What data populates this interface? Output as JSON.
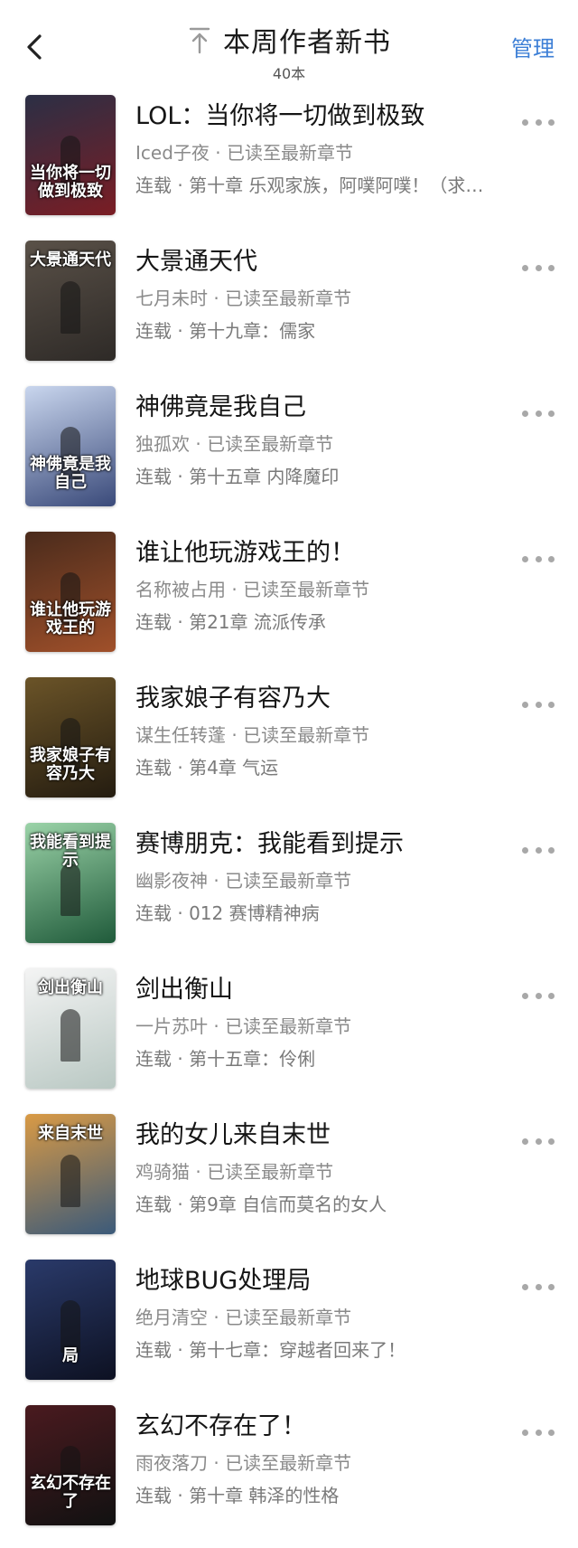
{
  "header": {
    "title": "本周作者新书",
    "count": "40本",
    "manage_label": "管理",
    "icons": {
      "back": "chevron-left-icon",
      "up": "arrow-up-to-top-icon"
    },
    "accent_color": "#3d7fd6"
  },
  "separator": " · ",
  "books": [
    {
      "title": "LOL：当你将一切做到极致",
      "author": "Iced子夜",
      "progress": "已读至最新章节",
      "status": "连载",
      "chapter": "第十章 乐观家族，阿噗阿噗！（求…",
      "cover_text": "当你将一切做到极致",
      "cover_colors": [
        "#2b2f45",
        "#7a1d24"
      ]
    },
    {
      "title": "大景通天代",
      "author": "七月未时",
      "progress": "已读至最新章节",
      "status": "连载",
      "chapter": "第十九章：儒家",
      "cover_text": "大景通天代",
      "cover_colors": [
        "#5a5148",
        "#2e2a27"
      ]
    },
    {
      "title": "神佛竟是我自己",
      "author": "独孤欢",
      "progress": "已读至最新章节",
      "status": "连载",
      "chapter": "第十五章 内降魔印",
      "cover_text": "神佛竟是我自己",
      "cover_colors": [
        "#c9d6ee",
        "#3a4a7a"
      ]
    },
    {
      "title": "谁让他玩游戏王的！",
      "author": "名称被占用",
      "progress": "已读至最新章节",
      "status": "连载",
      "chapter": "第21章 流派传承",
      "cover_text": "谁让他玩游戏王的",
      "cover_colors": [
        "#4a2b1c",
        "#a0502a"
      ]
    },
    {
      "title": "我家娘子有容乃大",
      "author": "谋生任转蓬",
      "progress": "已读至最新章节",
      "status": "连载",
      "chapter": "第4章 气运",
      "cover_text": "我家娘子有容乃大",
      "cover_colors": [
        "#6b5428",
        "#241c10"
      ]
    },
    {
      "title": "赛博朋克：我能看到提示",
      "author": "幽影夜神",
      "progress": "已读至最新章节",
      "status": "连载",
      "chapter": "012 赛博精神病",
      "cover_text": "我能看到提示",
      "cover_colors": [
        "#9bd3a8",
        "#1f5a3a"
      ]
    },
    {
      "title": "剑出衡山",
      "author": "一片苏叶",
      "progress": "已读至最新章节",
      "status": "连载",
      "chapter": "第十五章：伶俐",
      "cover_text": "剑出衡山",
      "cover_colors": [
        "#f4f4f4",
        "#b9c8c3"
      ]
    },
    {
      "title": "我的女儿来自末世",
      "author": "鸡骑猫",
      "progress": "已读至最新章节",
      "status": "连载",
      "chapter": "第9章 自信而莫名的女人",
      "cover_text": "来自末世",
      "cover_colors": [
        "#d99a45",
        "#3b5a7a"
      ]
    },
    {
      "title": "地球BUG处理局",
      "author": "绝月清空",
      "progress": "已读至最新章节",
      "status": "连载",
      "chapter": "第十七章：穿越者回来了！",
      "cover_text": "局",
      "cover_colors": [
        "#2a3a6a",
        "#0d1122"
      ]
    },
    {
      "title": "玄幻不存在了！",
      "author": "雨夜落刀",
      "progress": "已读至最新章节",
      "status": "连载",
      "chapter": "第十章 韩泽的性格",
      "cover_text": "玄幻不存在了",
      "cover_colors": [
        "#4a1a1f",
        "#111111"
      ]
    }
  ]
}
